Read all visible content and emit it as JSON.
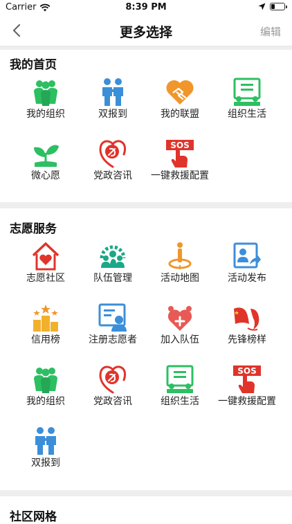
{
  "status": {
    "carrier": "Carrier",
    "time": "8:39 PM"
  },
  "nav": {
    "title": "更多选择",
    "edit": "编辑"
  },
  "sections": [
    {
      "title": "我的首页",
      "items": [
        {
          "label": "我的组织",
          "icon": "group-icon"
        },
        {
          "label": "双报到",
          "icon": "two-people-icon"
        },
        {
          "label": "我的联盟",
          "icon": "heart-handshake-icon"
        },
        {
          "label": "组织生活",
          "icon": "meeting-board-icon"
        },
        {
          "label": "微心愿",
          "icon": "sprout-icon"
        },
        {
          "label": "党政咨讯",
          "icon": "party-emblem-icon"
        },
        {
          "label": "一键救援配置",
          "icon": "sos-icon"
        }
      ]
    },
    {
      "title": "志愿服务",
      "items": [
        {
          "label": "志愿社区",
          "icon": "heart-house-icon"
        },
        {
          "label": "队伍管理",
          "icon": "team-gear-icon"
        },
        {
          "label": "活动地图",
          "icon": "map-pin-person-icon"
        },
        {
          "label": "活动发布",
          "icon": "share-card-icon"
        },
        {
          "label": "信用榜",
          "icon": "podium-stars-icon"
        },
        {
          "label": "注册志愿者",
          "icon": "register-card-icon"
        },
        {
          "label": "加入队伍",
          "icon": "heart-plus-icon"
        },
        {
          "label": "先锋榜样",
          "icon": "flag-pioneer-icon"
        },
        {
          "label": "我的组织",
          "icon": "group-icon"
        },
        {
          "label": "党政咨讯",
          "icon": "party-emblem-icon"
        },
        {
          "label": "组织生活",
          "icon": "meeting-board-icon"
        },
        {
          "label": "一键救援配置",
          "icon": "sos-icon"
        },
        {
          "label": "双报到",
          "icon": "two-people-icon"
        }
      ]
    },
    {
      "title": "社区网格",
      "items": []
    }
  ],
  "colors": {
    "green": "#2dbf62",
    "blue": "#3b8fd9",
    "orange": "#f0962a",
    "red": "#e0342b",
    "teal": "#1aa887",
    "gold": "#f2b12c"
  }
}
